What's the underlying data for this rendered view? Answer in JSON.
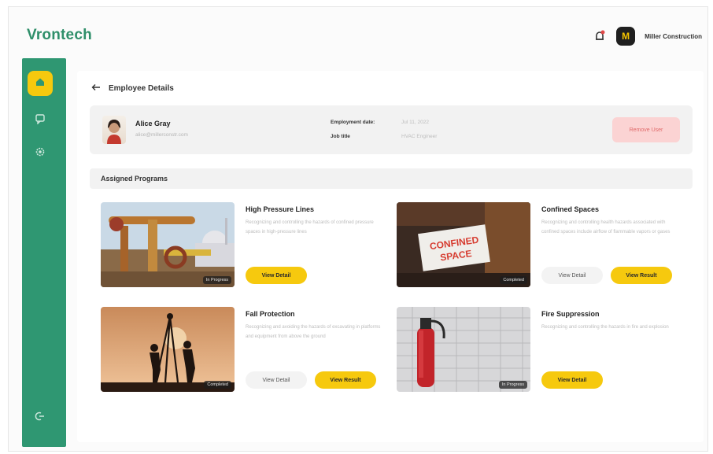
{
  "app": {
    "brand": "Vrontech",
    "company": "Miller Construction",
    "company_initial": "M"
  },
  "sidebar": {
    "items": [
      {
        "icon": "home-icon"
      },
      {
        "icon": "chat-icon"
      },
      {
        "icon": "gear-icon"
      },
      {
        "icon": "logout-icon"
      }
    ]
  },
  "header": {
    "back_label": "Employee Details"
  },
  "employee": {
    "name": "Alice Gray",
    "email": "alice@millerconstr.com",
    "employment_date_label": "Employment date:",
    "employment_date": "Jul 11, 2022",
    "job_title_label": "Job title",
    "job_title": "HVAC Engineer",
    "remove_label": "Remove User"
  },
  "assigned": {
    "title": "Assigned Programs"
  },
  "programs": [
    {
      "title": "High Pressure Lines",
      "description": "Recognizing and controlling the hazards of confined pressure spaces in high-pressure lines",
      "badge": "In Progress",
      "buttons": [
        "View Detail"
      ]
    },
    {
      "title": "Confined Spaces",
      "description": "Recognizing and controlling health hazards associated with confined spaces include airflow of flammable vapors or gases",
      "badge": "Completed",
      "buttons": [
        "View Detail",
        "View Result"
      ]
    },
    {
      "title": "Fall Protection",
      "description": "Recognizing and avoiding the hazards of excavating in platforms and equipment from above the ground",
      "badge": "Completed",
      "buttons": [
        "View Detail",
        "View Result"
      ]
    },
    {
      "title": "Fire Suppression",
      "description": "Recognizing and controlling the hazards in fire and explosion",
      "badge": "In Progress",
      "buttons": [
        "View Detail"
      ]
    }
  ],
  "colors": {
    "accent_green": "#2f9772",
    "accent_yellow": "#f6c90e",
    "danger_bg": "#fbd3d3",
    "danger_text": "#e06b6b"
  }
}
